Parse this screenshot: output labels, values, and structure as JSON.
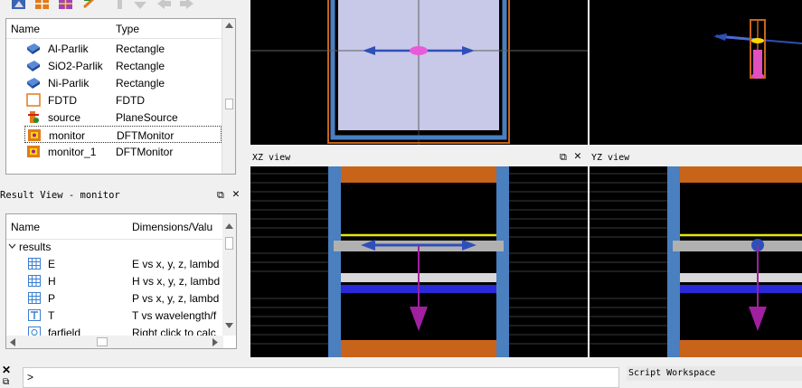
{
  "objects_tree": {
    "columns": [
      "Name",
      "Type"
    ],
    "rows": [
      {
        "name": "Al-Parlik",
        "type": "Rectangle",
        "icon": "rectangle-icon"
      },
      {
        "name": "SiO2-Parlik",
        "type": "Rectangle",
        "icon": "rectangle-icon"
      },
      {
        "name": "Ni-Parlik",
        "type": "Rectangle",
        "icon": "rectangle-icon"
      },
      {
        "name": "FDTD",
        "type": "FDTD",
        "icon": "fdtd-icon"
      },
      {
        "name": "source",
        "type": "PlaneSource",
        "icon": "source-icon"
      },
      {
        "name": "monitor",
        "type": "DFTMonitor",
        "icon": "monitor-icon"
      },
      {
        "name": "monitor_1",
        "type": "DFTMonitor",
        "icon": "monitor-icon"
      }
    ]
  },
  "result_view": {
    "title": "Result View - monitor",
    "columns": [
      "Name",
      "Dimensions/Valu"
    ],
    "group": "results",
    "rows": [
      {
        "name": "E",
        "desc": "E vs x, y, z, lambd"
      },
      {
        "name": "H",
        "desc": "H vs x, y, z, lambd"
      },
      {
        "name": "P",
        "desc": "P vs x, y, z, lambd"
      },
      {
        "name": "T",
        "desc": "T vs wavelength/f"
      },
      {
        "name": "farfield",
        "desc": "Right click to calc"
      }
    ]
  },
  "views": {
    "xz_label": "XZ view",
    "yz_label": "YZ view"
  },
  "bottom": {
    "console_prompt": ">",
    "script_workspace": "Script Workspace"
  },
  "colors": {
    "view_bg": "#000000",
    "orange": "#c8641a",
    "blue_layer": "#2a2ad8",
    "yellow": "#e8e800",
    "source_arrow": "#2f4fb8",
    "monitor_arrow": "#a020a0"
  }
}
